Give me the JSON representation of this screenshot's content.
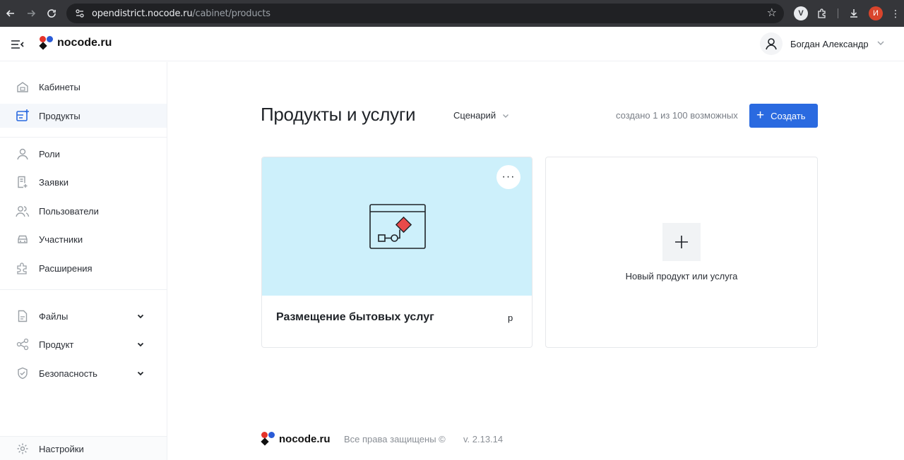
{
  "browser": {
    "url_host": "opendistrict.nocode.ru",
    "url_path": "/cabinet/products",
    "profile_initial": "И"
  },
  "header": {
    "logo_text": "nocode.ru",
    "user_name": "Богдан Александр"
  },
  "sidebar": {
    "items": [
      {
        "label": "Кабинеты",
        "icon": "home-icon"
      },
      {
        "label": "Продукты",
        "icon": "products-icon",
        "active": true
      },
      {
        "label": "Роли",
        "icon": "user-icon"
      },
      {
        "label": "Заявки",
        "icon": "document-icon"
      },
      {
        "label": "Пользователи",
        "icon": "users-icon"
      },
      {
        "label": "Участники",
        "icon": "car-icon"
      },
      {
        "label": "Расширения",
        "icon": "puzzle-icon"
      },
      {
        "label": "Файлы",
        "icon": "file-icon",
        "expandable": true
      },
      {
        "label": "Продукт",
        "icon": "share-icon",
        "expandable": true
      },
      {
        "label": "Безопасность",
        "icon": "shield-icon",
        "expandable": true
      },
      {
        "label": "Настройки",
        "icon": "gear-icon"
      }
    ]
  },
  "main": {
    "title": "Продукты и услуги",
    "filter_label": "Сценарий",
    "count_text": "создано 1 из 100 возможных",
    "create_label": "Создать",
    "product_card": {
      "title": "Размещение бытовых услуг",
      "badge": "р",
      "more_label": "···"
    },
    "new_card_label": "Новый продукт или услуга"
  },
  "footer": {
    "logo_text": "nocode.ru",
    "rights": "Все права защищены ©",
    "version": "v. 2.13.14"
  },
  "colors": {
    "accent": "#2a6ae0",
    "card_cover": "#cdf0fb",
    "logo_red": "#e5332a",
    "logo_blue": "#2a5bd7",
    "illustration_diamond": "#e84a4a"
  }
}
